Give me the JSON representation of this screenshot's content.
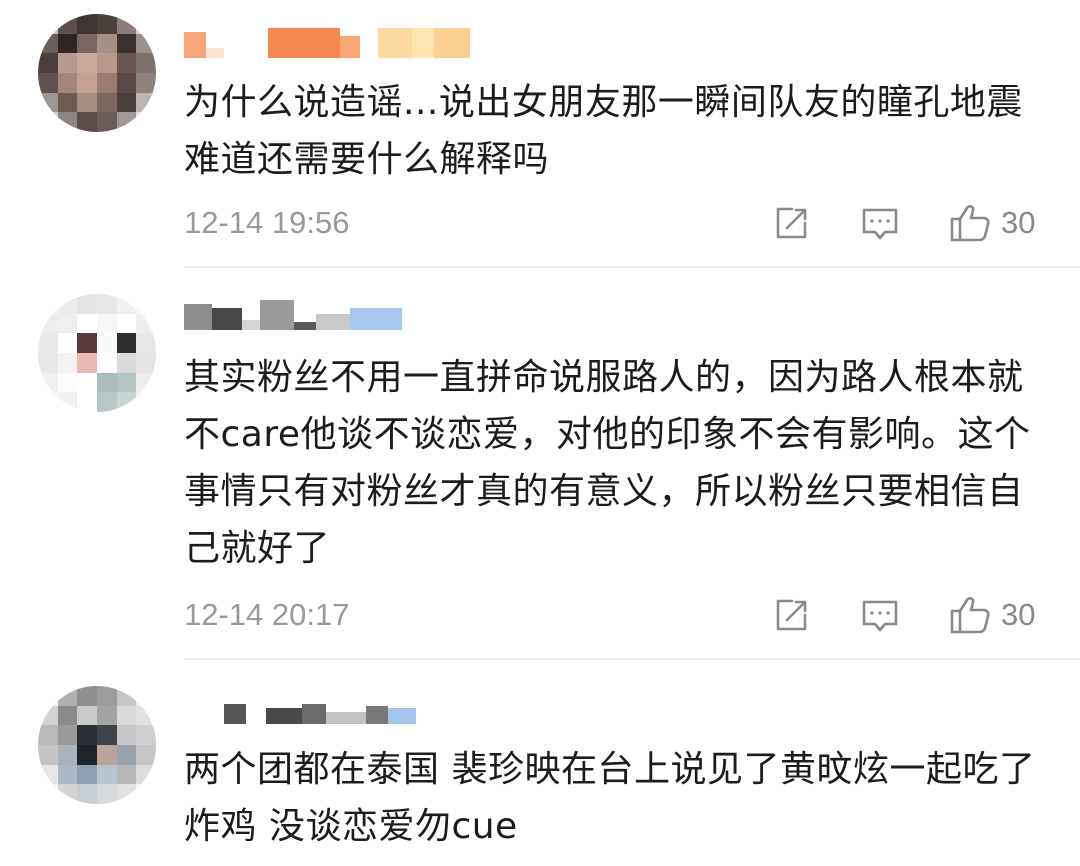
{
  "comments": [
    {
      "text": "为什么说造谣...说出女朋友那一瞬间队友的瞳孔地震难道还需要什么解释吗",
      "time": "12-14 19:56",
      "likes": "30"
    },
    {
      "text": "其实粉丝不用一直拼命说服路人的，因为路人根本就不care他谈不谈恋爱，对他的印象不会有影响。这个事情只有对粉丝才真的有意义，所以粉丝只要相信自己就好了",
      "time": "12-14 20:17",
      "likes": "30"
    },
    {
      "text": "两个团都在泰国 裴珍映在台上说见了黄旼炫一起吃了炸鸡 没谈恋爱勿cue"
    }
  ],
  "icons": {
    "share": "share-icon",
    "reply": "comment-icon",
    "like": "thumbs-up-icon"
  },
  "colors": {
    "text": "#1c1c1c",
    "meta": "#9a9a9a",
    "icon": "#8a8a8a",
    "divider": "#ececec"
  }
}
